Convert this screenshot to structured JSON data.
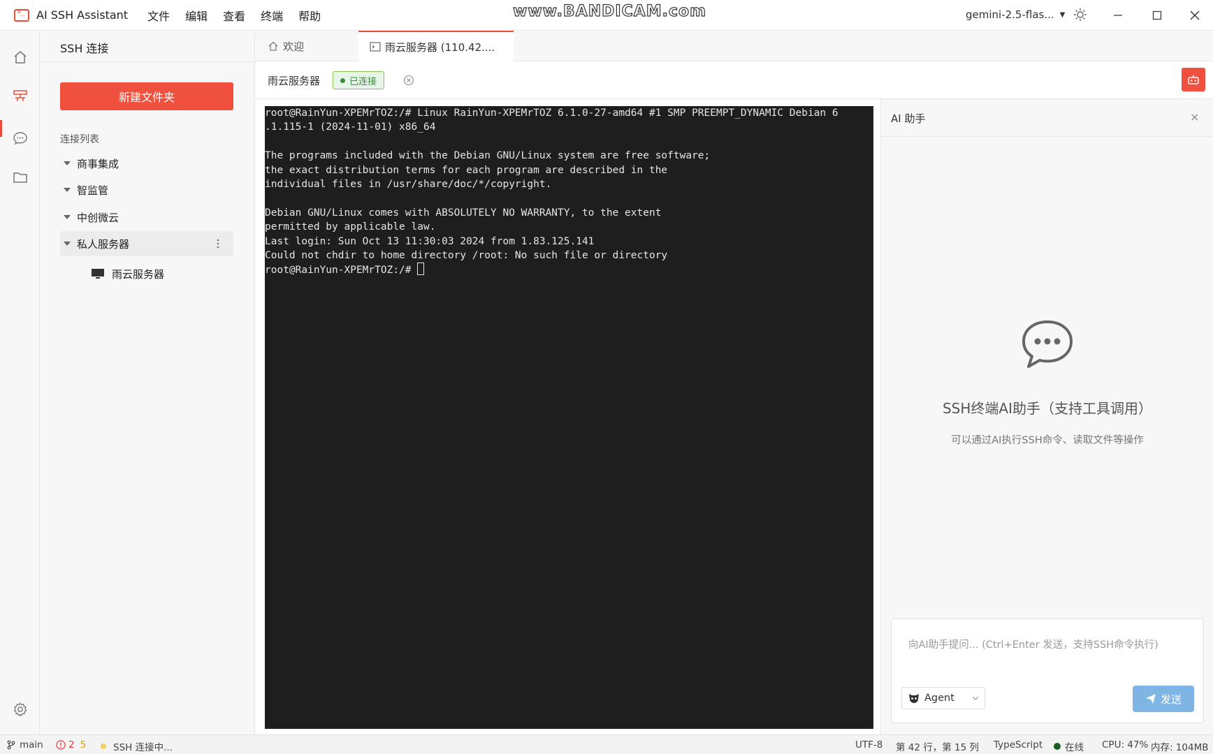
{
  "titlebar": {
    "app_title": "AI SSH Assistant",
    "menu": [
      "文件",
      "编辑",
      "查看",
      "终端",
      "帮助"
    ],
    "watermark": "www.BANDICAM.com",
    "model": "gemini-2.5-flas..."
  },
  "sidebar": {
    "title": "SSH 连接",
    "new_folder_label": "新建文件夹",
    "list_label": "连接列表",
    "groups": [
      "商事集成",
      "智监管",
      "中创微云",
      "私人服务器"
    ],
    "server": "雨云服务器"
  },
  "tabs": {
    "welcome": "欢迎",
    "server": "雨云服务器 (110.42...."
  },
  "session": {
    "name": "雨云服务器",
    "status": "已连接"
  },
  "terminal": {
    "lines": [
      "root@RainYun-XPEMrTOZ:/# Linux RainYun-XPEMrTOZ 6.1.0-27-amd64 #1 SMP PREEMPT_DYNAMIC Debian 6",
      ".1.115-1 (2024-11-01) x86_64",
      "",
      "The programs included with the Debian GNU/Linux system are free software;",
      "the exact distribution terms for each program are described in the",
      "individual files in /usr/share/doc/*/copyright.",
      "",
      "Debian GNU/Linux comes with ABSOLUTELY NO WARRANTY, to the extent",
      "permitted by applicable law.",
      "Last login: Sun Oct 13 11:30:03 2024 from 1.83.125.141",
      "Could not chdir to home directory /root: No such file or directory"
    ],
    "prompt": "root@RainYun-XPEMrTOZ:/# "
  },
  "ai": {
    "title": "AI 助手",
    "close": "×",
    "heading": "SSH终端AI助手（支持工具调用）",
    "subtitle": "可以通过AI执行SSH命令、读取文件等操作",
    "placeholder": "向AI助手提问... (Ctrl+Enter 发送，支持SSH命令执行)",
    "mode": "Agent",
    "send_label": "发送"
  },
  "statusbar": {
    "branch": "main",
    "errors": "2",
    "warnings": "5",
    "connection": "SSH 连接中...",
    "encoding": "UTF-8",
    "position": "第 42 行，第 15 列",
    "language": "TypeScript",
    "online": "在线",
    "cpu": "CPU: 47%",
    "memory": "内存: 104MB"
  },
  "colors": {
    "accent": "#f0513f",
    "connected": "#388e3c",
    "send": "#7fb5e4",
    "terminal_bg": "#1e1e1e"
  }
}
